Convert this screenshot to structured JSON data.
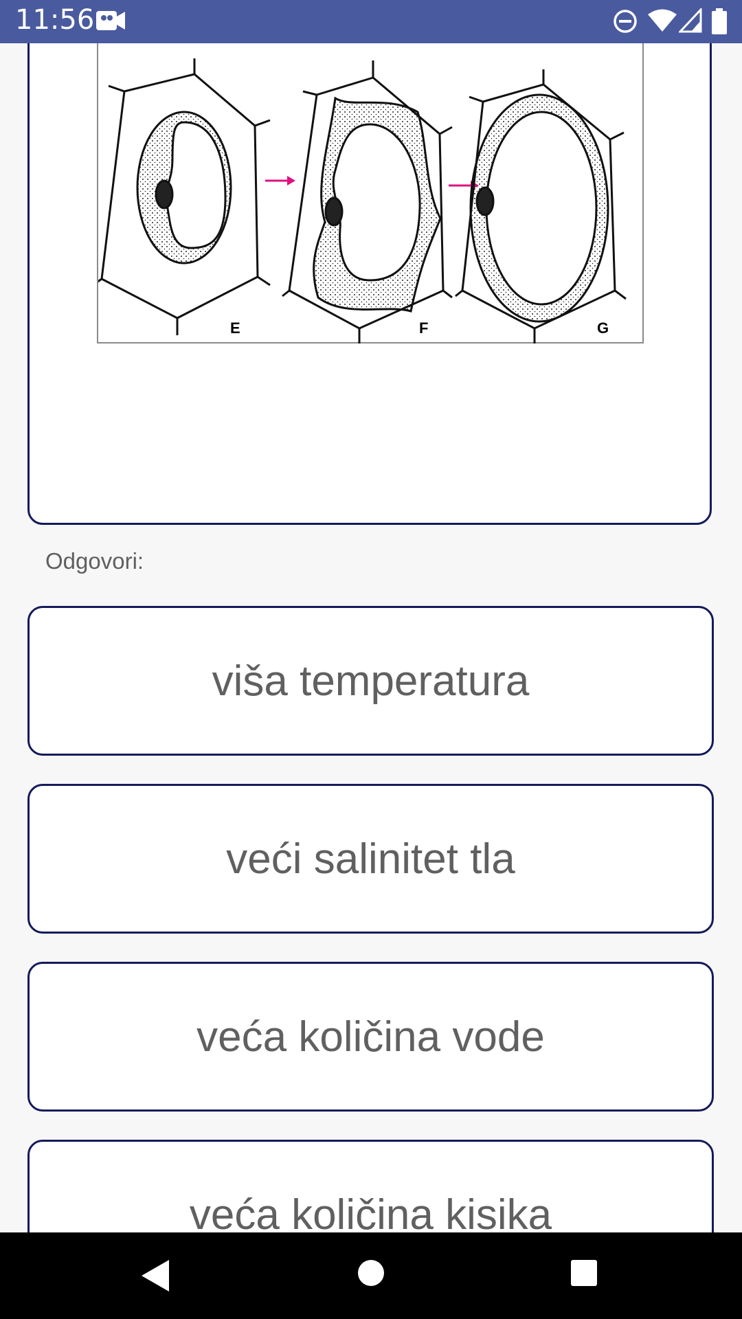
{
  "status_bar": {
    "time": "11:56",
    "icons": [
      "video-camera-icon",
      "do-not-disturb-icon",
      "wifi-icon",
      "signal-icon",
      "battery-icon"
    ],
    "background": "#4a5a9f"
  },
  "question": {
    "figure_labels": [
      "E",
      "F",
      "G"
    ],
    "arrow_color": "#e0117f"
  },
  "answers": {
    "label": "Odgovori:",
    "options": [
      "viša temperatura",
      "veći salinitet tla",
      "veća količina vode",
      "veća količina kisika"
    ]
  },
  "nav_bar": {
    "icons": [
      "back-icon",
      "home-icon",
      "recents-icon"
    ]
  }
}
